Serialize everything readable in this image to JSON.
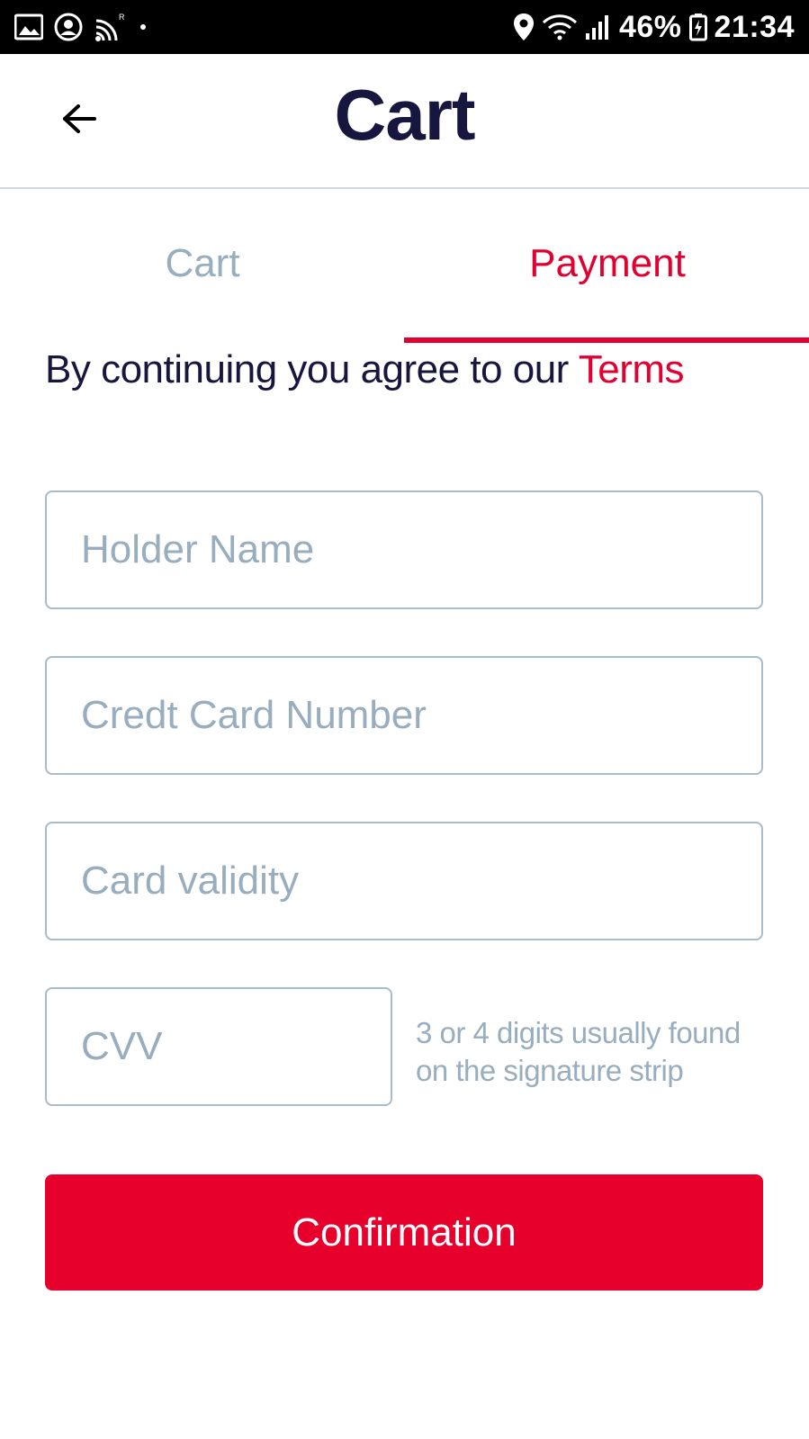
{
  "status_bar": {
    "battery": "46%",
    "time": "21:34",
    "left_icons": [
      "image-icon",
      "account-circle-icon",
      "cast-icon",
      "notification-dot"
    ],
    "right_icons": [
      "location-icon",
      "wifi-icon",
      "signal-icon",
      "battery-charging-icon"
    ]
  },
  "header": {
    "title": "Cart",
    "back_icon": "arrow-left-icon"
  },
  "tabs": [
    {
      "label": "Cart",
      "active": false
    },
    {
      "label": "Payment",
      "active": true
    }
  ],
  "terms": {
    "text": "By continuing you agree to our ",
    "link": "Terms"
  },
  "form": {
    "holder_name_placeholder": "Holder Name",
    "card_number_placeholder": "Credt Card Number",
    "validity_placeholder": "Card validity",
    "cvv_placeholder": "CVV",
    "cvv_hint": "3 or 4 digits usually found on the signature strip"
  },
  "confirm_button": {
    "label": "Confirmation"
  },
  "colors": {
    "accent_red": "#e20030",
    "title_navy": "#16163f",
    "muted_blue_gray": "#98adbe",
    "field_border": "#a9bccb"
  }
}
